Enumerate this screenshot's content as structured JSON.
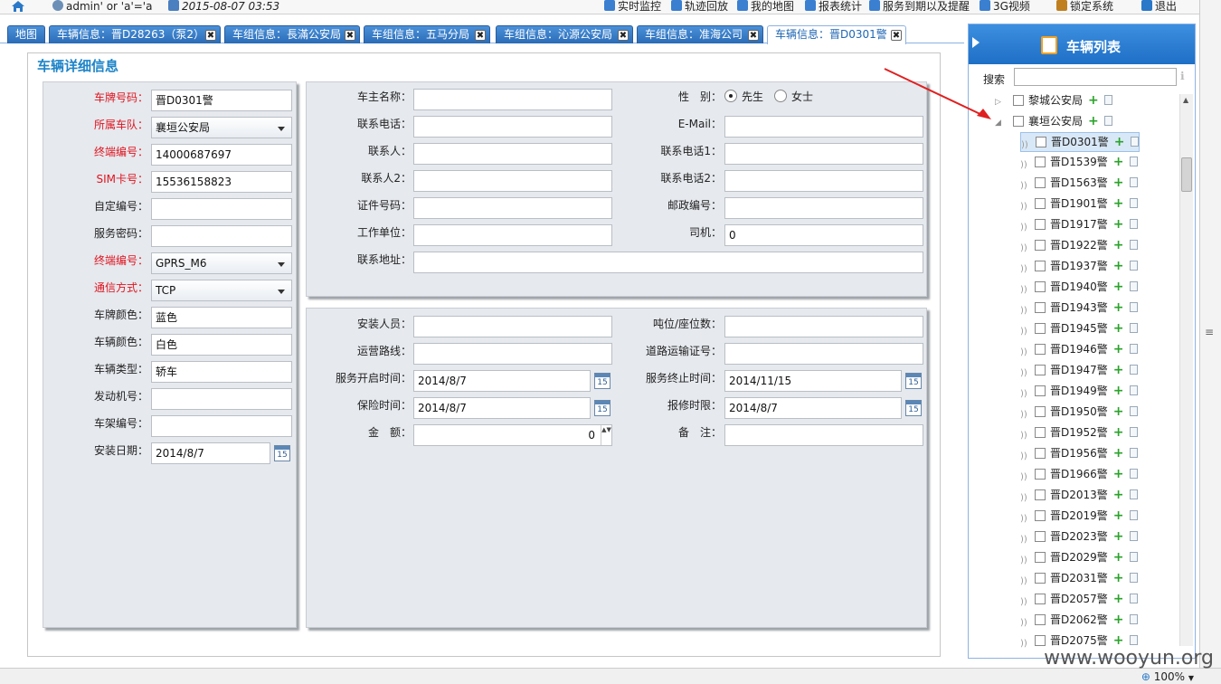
{
  "topbar": {
    "user": "admin' or 'a'='a",
    "datetime": "2015-08-07 03:53",
    "nav": [
      {
        "label": "实时监控",
        "icon": "signal-icon"
      },
      {
        "label": "轨迹回放",
        "icon": "track-icon"
      },
      {
        "label": "我的地图",
        "icon": "map-icon"
      },
      {
        "label": "报表统计",
        "icon": "report-icon"
      },
      {
        "label": "服务到期以及提醒",
        "icon": "bell-icon"
      },
      {
        "label": "3G视频",
        "icon": "video-icon"
      },
      {
        "label": "锁定系统",
        "icon": "lock-icon"
      },
      {
        "label": "退出",
        "icon": "power-icon"
      }
    ]
  },
  "tabs": [
    {
      "label": "地图",
      "closable": false
    },
    {
      "label": "车辆信息：晋D28263（泵2）",
      "closable": true
    },
    {
      "label": "车组信息：長滿公安局",
      "closable": true
    },
    {
      "label": "车组信息：五马分局",
      "closable": true
    },
    {
      "label": "车组信息：沁源公安局",
      "closable": true
    },
    {
      "label": "车组信息：准海公司",
      "closable": true
    },
    {
      "label": "车辆信息：晋D0301警",
      "closable": true,
      "active": true
    }
  ],
  "main": {
    "title": "车辆详细信息",
    "left": [
      {
        "label": "车牌号码：",
        "value": "晋D0301警",
        "required": true,
        "type": "text"
      },
      {
        "label": "所属车队：",
        "value": "襄垣公安局",
        "required": true,
        "type": "select"
      },
      {
        "label": "终端编号：",
        "value": "14000687697",
        "required": true,
        "type": "text"
      },
      {
        "label": "SIM卡号：",
        "value": "15536158823",
        "required": true,
        "type": "text"
      },
      {
        "label": "自定编号：",
        "value": "",
        "required": false,
        "type": "text"
      },
      {
        "label": "服务密码：",
        "value": "",
        "required": false,
        "type": "text"
      },
      {
        "label": "终端编号：",
        "value": "GPRS_M6",
        "required": true,
        "type": "select"
      },
      {
        "label": "通信方式：",
        "value": "TCP",
        "required": true,
        "type": "select"
      },
      {
        "label": "车牌颜色：",
        "value": "蓝色",
        "required": false,
        "type": "text"
      },
      {
        "label": "车辆颜色：",
        "value": "白色",
        "required": false,
        "type": "text"
      },
      {
        "label": "车辆类型：",
        "value": "轿车",
        "required": false,
        "type": "text"
      },
      {
        "label": "发动机号：",
        "value": "",
        "required": false,
        "type": "text"
      },
      {
        "label": "车架编号：",
        "value": "",
        "required": false,
        "type": "text"
      },
      {
        "label": "安装日期：",
        "value": "2014/8/7",
        "required": false,
        "type": "date"
      }
    ],
    "owner": {
      "rows": [
        {
          "l1": "车主名称：",
          "v1": "",
          "l2": "性　别：",
          "radio": true
        },
        {
          "l1": "联系电话：",
          "v1": "",
          "l2": "E-Mail：",
          "v2": ""
        },
        {
          "l1": "联系人：",
          "v1": "",
          "l2": "联系电话1：",
          "v2": ""
        },
        {
          "l1": "联系人2：",
          "v1": "",
          "l2": "联系电话2：",
          "v2": ""
        },
        {
          "l1": "证件号码：",
          "v1": "",
          "l2": "邮政编号：",
          "v2": ""
        },
        {
          "l1": "工作单位：",
          "v1": "",
          "l2": "司机：",
          "v2": "0"
        }
      ],
      "gender_male": "先生",
      "gender_female": "女士",
      "address_label": "联系地址：",
      "address_value": ""
    },
    "install": {
      "rows": [
        {
          "l1": "安装人员：",
          "v1": "",
          "l2": "吨位/座位数：",
          "v2": ""
        },
        {
          "l1": "运营路线：",
          "v1": "",
          "l2": "道路运输证号：",
          "v2": ""
        },
        {
          "l1": "服务开启时间：",
          "v1": "2014/8/7",
          "date1": true,
          "l2": "服务终止时间：",
          "v2": "2014/11/15",
          "date2": true
        },
        {
          "l1": "保险时间：",
          "v1": "2014/8/7",
          "date1": true,
          "l2": "报修时限：",
          "v2": "2014/8/7",
          "date2": true
        },
        {
          "l1": "金　额：",
          "v1": "0",
          "spin": true,
          "l2": "备　注：",
          "v2": ""
        }
      ]
    },
    "calendar_glyph": "15"
  },
  "vehicle_list": {
    "title": "车辆列表",
    "search_label": "搜索",
    "search_value": "",
    "groups": [
      {
        "label": "黎城公安局",
        "expanded": false
      },
      {
        "label": "襄垣公安局",
        "expanded": true
      }
    ],
    "vehicles": [
      "晋D0301警",
      "晋D1539警",
      "晋D1563警",
      "晋D1901警",
      "晋D1917警",
      "晋D1922警",
      "晋D1937警",
      "晋D1940警",
      "晋D1943警",
      "晋D1945警",
      "晋D1946警",
      "晋D1947警",
      "晋D1949警",
      "晋D1950警",
      "晋D1952警",
      "晋D1956警",
      "晋D1966警",
      "晋D2013警",
      "晋D2019警",
      "晋D2023警",
      "晋D2029警",
      "晋D2031警",
      "晋D2057警",
      "晋D2062警",
      "晋D2075警"
    ],
    "selected_index": 0
  },
  "status": {
    "zoom": "100%"
  },
  "watermark": "www.wooyun.org",
  "colors": {
    "accent": "#1e84c8",
    "required": "#e0141e",
    "tab": "#2b6cb7"
  }
}
